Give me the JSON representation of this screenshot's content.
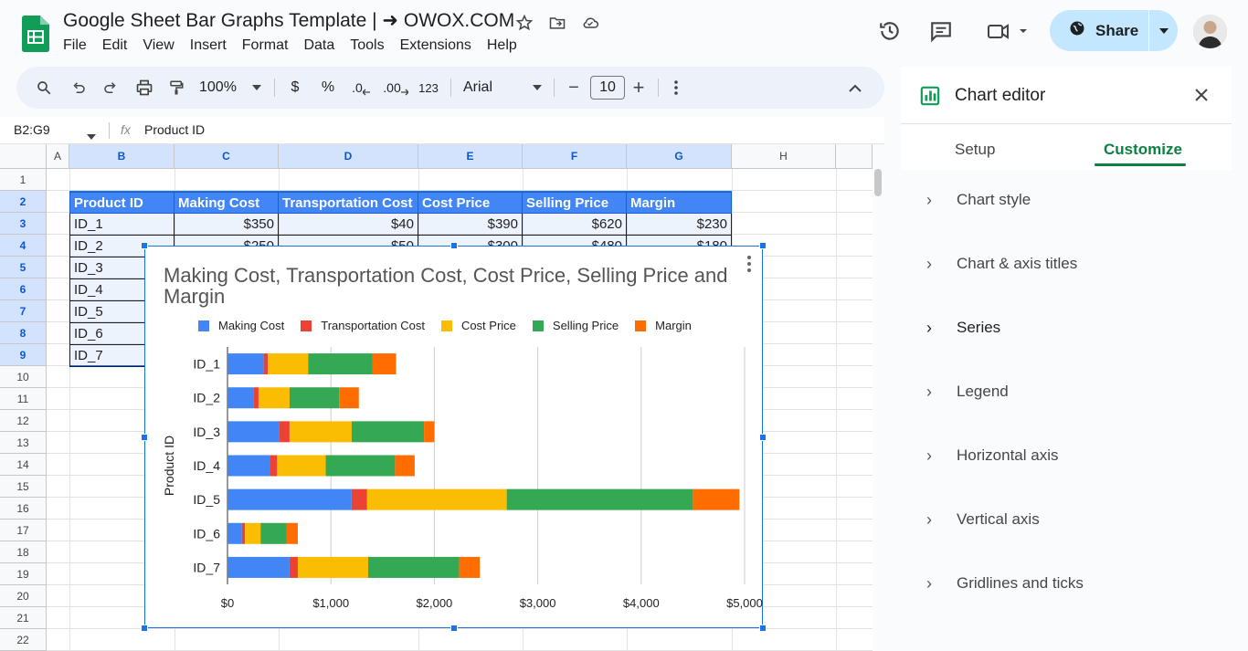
{
  "doc": {
    "title": "Google Sheet Bar Graphs Template | ➜ OWOX.COM",
    "menu": [
      "File",
      "Edit",
      "View",
      "Insert",
      "Format",
      "Data",
      "Tools",
      "Extensions",
      "Help"
    ],
    "share_label": "Share"
  },
  "toolbar": {
    "zoom": "100%",
    "currency": "$",
    "percent": "%",
    "dec_dec": ".0",
    "inc_dec": ".00",
    "number_format": "123",
    "font": "Arial",
    "font_size": "10",
    "minus": "−",
    "plus": "+"
  },
  "formula": {
    "name_box": "B2:G9",
    "fx": "fx",
    "content": "Product ID"
  },
  "columns": [
    "A",
    "B",
    "C",
    "D",
    "E",
    "F",
    "G",
    "H"
  ],
  "rows": [
    "1",
    "2",
    "3",
    "4",
    "5",
    "6",
    "7",
    "8",
    "9",
    "10",
    "11",
    "12",
    "13",
    "14",
    "15",
    "16",
    "17",
    "18",
    "19",
    "20",
    "21",
    "22"
  ],
  "table": {
    "headers": [
      "Product ID",
      "Making Cost",
      "Transportation Cost",
      "Cost Price",
      "Selling Price",
      "Margin"
    ],
    "row3": [
      "ID_1",
      "$350",
      "$40",
      "$390",
      "$620",
      "$230"
    ],
    "row4": [
      "ID_2",
      "$250",
      "$50",
      "$300",
      "$480",
      "$180"
    ],
    "ids": [
      "ID_3",
      "ID_4",
      "ID_5",
      "ID_6",
      "ID_7"
    ]
  },
  "chart_data": {
    "type": "bar",
    "orientation": "horizontal",
    "stacked": true,
    "title": "Making Cost, Transportation Cost, Cost Price, Selling Price and Margin",
    "ylabel": "Product ID",
    "xlabel": "",
    "categories": [
      "ID_1",
      "ID_2",
      "ID_3",
      "ID_4",
      "ID_5",
      "ID_6",
      "ID_7"
    ],
    "xlim": [
      0,
      5000
    ],
    "x_ticks": [
      "$0",
      "$1,000",
      "$2,000",
      "$3,000",
      "$4,000",
      "$5,000"
    ],
    "legend_position": "top",
    "gridlines": true,
    "series": [
      {
        "name": "Making Cost",
        "color": "#4285f4",
        "values": [
          350,
          250,
          500,
          410,
          1200,
          140,
          600
        ]
      },
      {
        "name": "Transportation Cost",
        "color": "#ea4335",
        "values": [
          40,
          50,
          100,
          70,
          150,
          30,
          80
        ]
      },
      {
        "name": "Cost Price",
        "color": "#fbbc04",
        "values": [
          390,
          300,
          600,
          470,
          1350,
          150,
          680
        ]
      },
      {
        "name": "Selling Price",
        "color": "#34a853",
        "values": [
          620,
          480,
          700,
          670,
          1800,
          250,
          880
        ]
      },
      {
        "name": "Margin",
        "color": "#ff6d01",
        "values": [
          230,
          190,
          100,
          190,
          450,
          110,
          200
        ]
      }
    ]
  },
  "panel": {
    "title": "Chart editor",
    "tabs": [
      "Setup",
      "Customize"
    ],
    "sections": [
      "Chart style",
      "Chart & axis titles",
      "Series",
      "Legend",
      "Horizontal axis",
      "Vertical axis",
      "Gridlines and ticks"
    ]
  }
}
